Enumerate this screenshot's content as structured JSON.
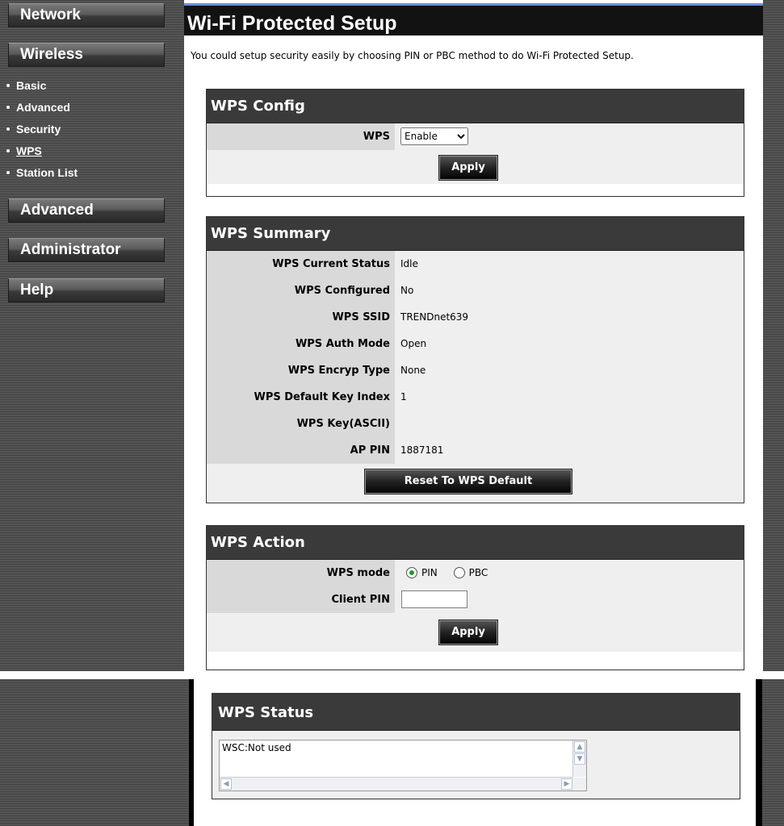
{
  "sidebar": {
    "nav": [
      {
        "label": "Network"
      },
      {
        "label": "Wireless"
      },
      {
        "label": "Advanced"
      },
      {
        "label": "Administrator"
      },
      {
        "label": "Help"
      }
    ],
    "wireless_items": [
      {
        "label": "Basic"
      },
      {
        "label": "Advanced"
      },
      {
        "label": "Security"
      },
      {
        "label": "WPS",
        "active": true
      },
      {
        "label": "Station List"
      }
    ]
  },
  "page": {
    "title": "Wi-Fi Protected Setup",
    "intro": "You could setup security easily by choosing PIN or PBC method to do Wi-Fi Protected Setup."
  },
  "wps_config": {
    "header": "WPS Config",
    "wps_label": "WPS",
    "wps_value": "Enable",
    "apply_label": "Apply"
  },
  "wps_summary": {
    "header": "WPS Summary",
    "rows": [
      {
        "label": "WPS Current Status",
        "value": "Idle"
      },
      {
        "label": "WPS Configured",
        "value": "No"
      },
      {
        "label": "WPS SSID",
        "value": "TRENDnet639"
      },
      {
        "label": "WPS Auth Mode",
        "value": "Open"
      },
      {
        "label": "WPS Encryp Type",
        "value": "None"
      },
      {
        "label": "WPS Default Key Index",
        "value": "1"
      },
      {
        "label": "WPS Key(ASCII)",
        "value": ""
      },
      {
        "label": "AP PIN",
        "value": "1887181"
      }
    ],
    "reset_label": "Reset To WPS Default"
  },
  "wps_action": {
    "header": "WPS Action",
    "mode_label": "WPS mode",
    "mode_options": [
      "PIN",
      "PBC"
    ],
    "mode_selected": "PIN",
    "client_pin_label": "Client PIN",
    "client_pin_value": "",
    "apply_label": "Apply"
  },
  "wps_status": {
    "header": "WPS Status",
    "text": "WSC:Not used"
  },
  "colors": {
    "title_bar": "#121212",
    "title_accent": "#6d8fd6",
    "panel_header": "#3a3a3a",
    "label_cell": "#d9d9d9",
    "value_cell": "#efefef",
    "radio_selected": "#1f9a2c"
  }
}
